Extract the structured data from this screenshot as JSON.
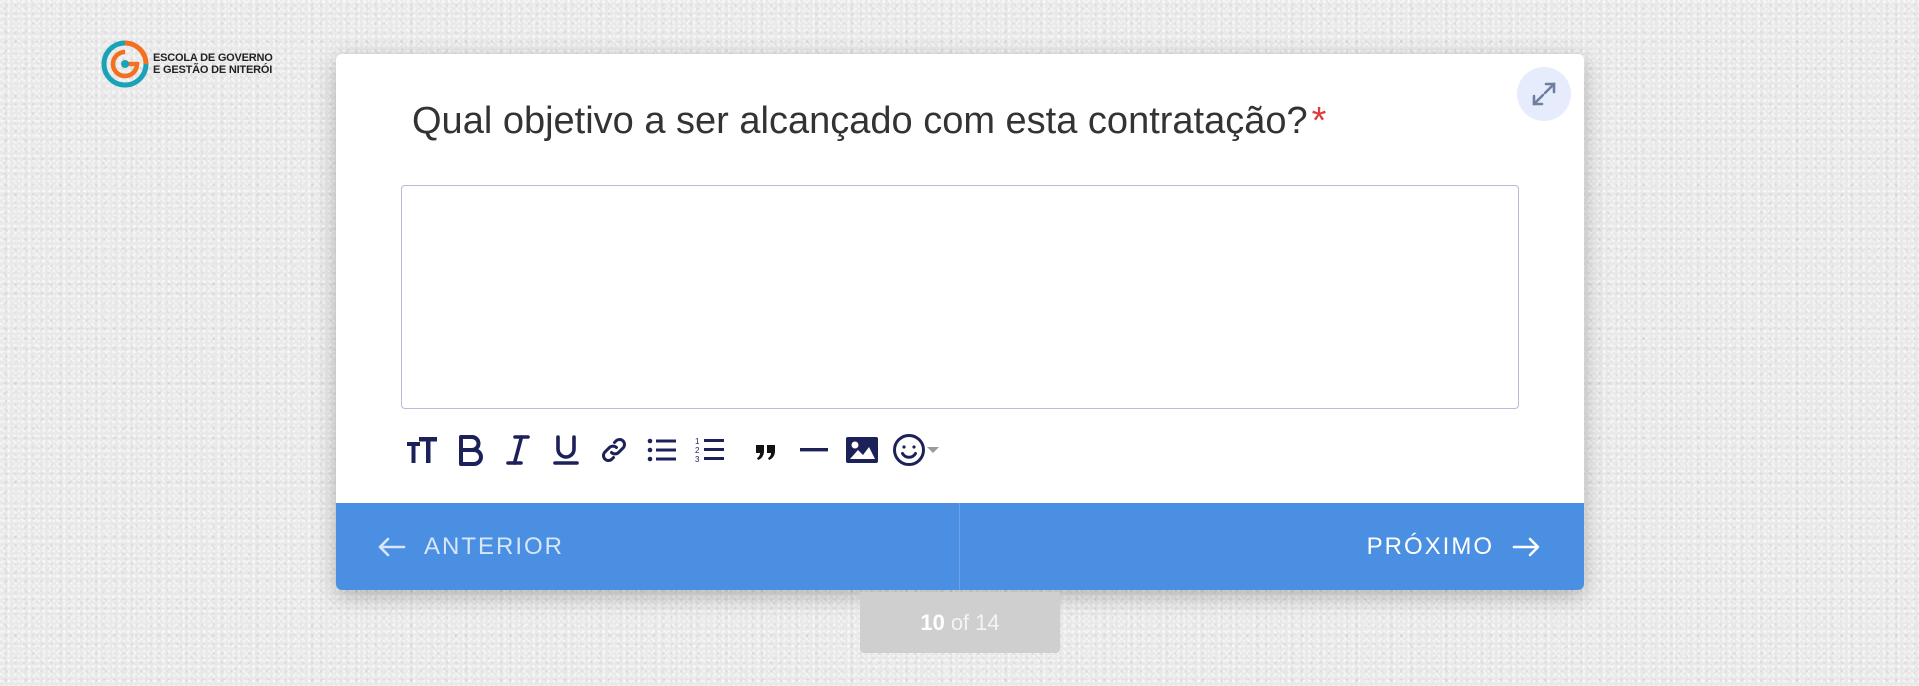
{
  "logo": {
    "line1": "ESCOLA DE GOVERNO",
    "line2": "E GESTÃO DE NITERÓI",
    "colors": {
      "teal": "#1aa3b8",
      "orange": "#f37021"
    }
  },
  "question": {
    "text": "Qual objetivo a ser alcançado com esta contratação?",
    "required_mark": "*"
  },
  "answer": {
    "value": ""
  },
  "toolbar": {
    "items": [
      "text-size-icon",
      "bold-icon",
      "italic-icon",
      "underline-icon",
      "link-icon",
      "bullet-list-icon",
      "numbered-list-icon",
      "quote-icon",
      "horizontal-rule-icon",
      "image-icon",
      "emoji-icon"
    ]
  },
  "footer": {
    "prev_label": "ANTERIOR",
    "next_label": "PRÓXIMO",
    "bar_color": "#4a8fe2"
  },
  "progress": {
    "current": "10",
    "of_label": "of",
    "total": "14"
  },
  "expand": {
    "icon": "expand-icon"
  }
}
